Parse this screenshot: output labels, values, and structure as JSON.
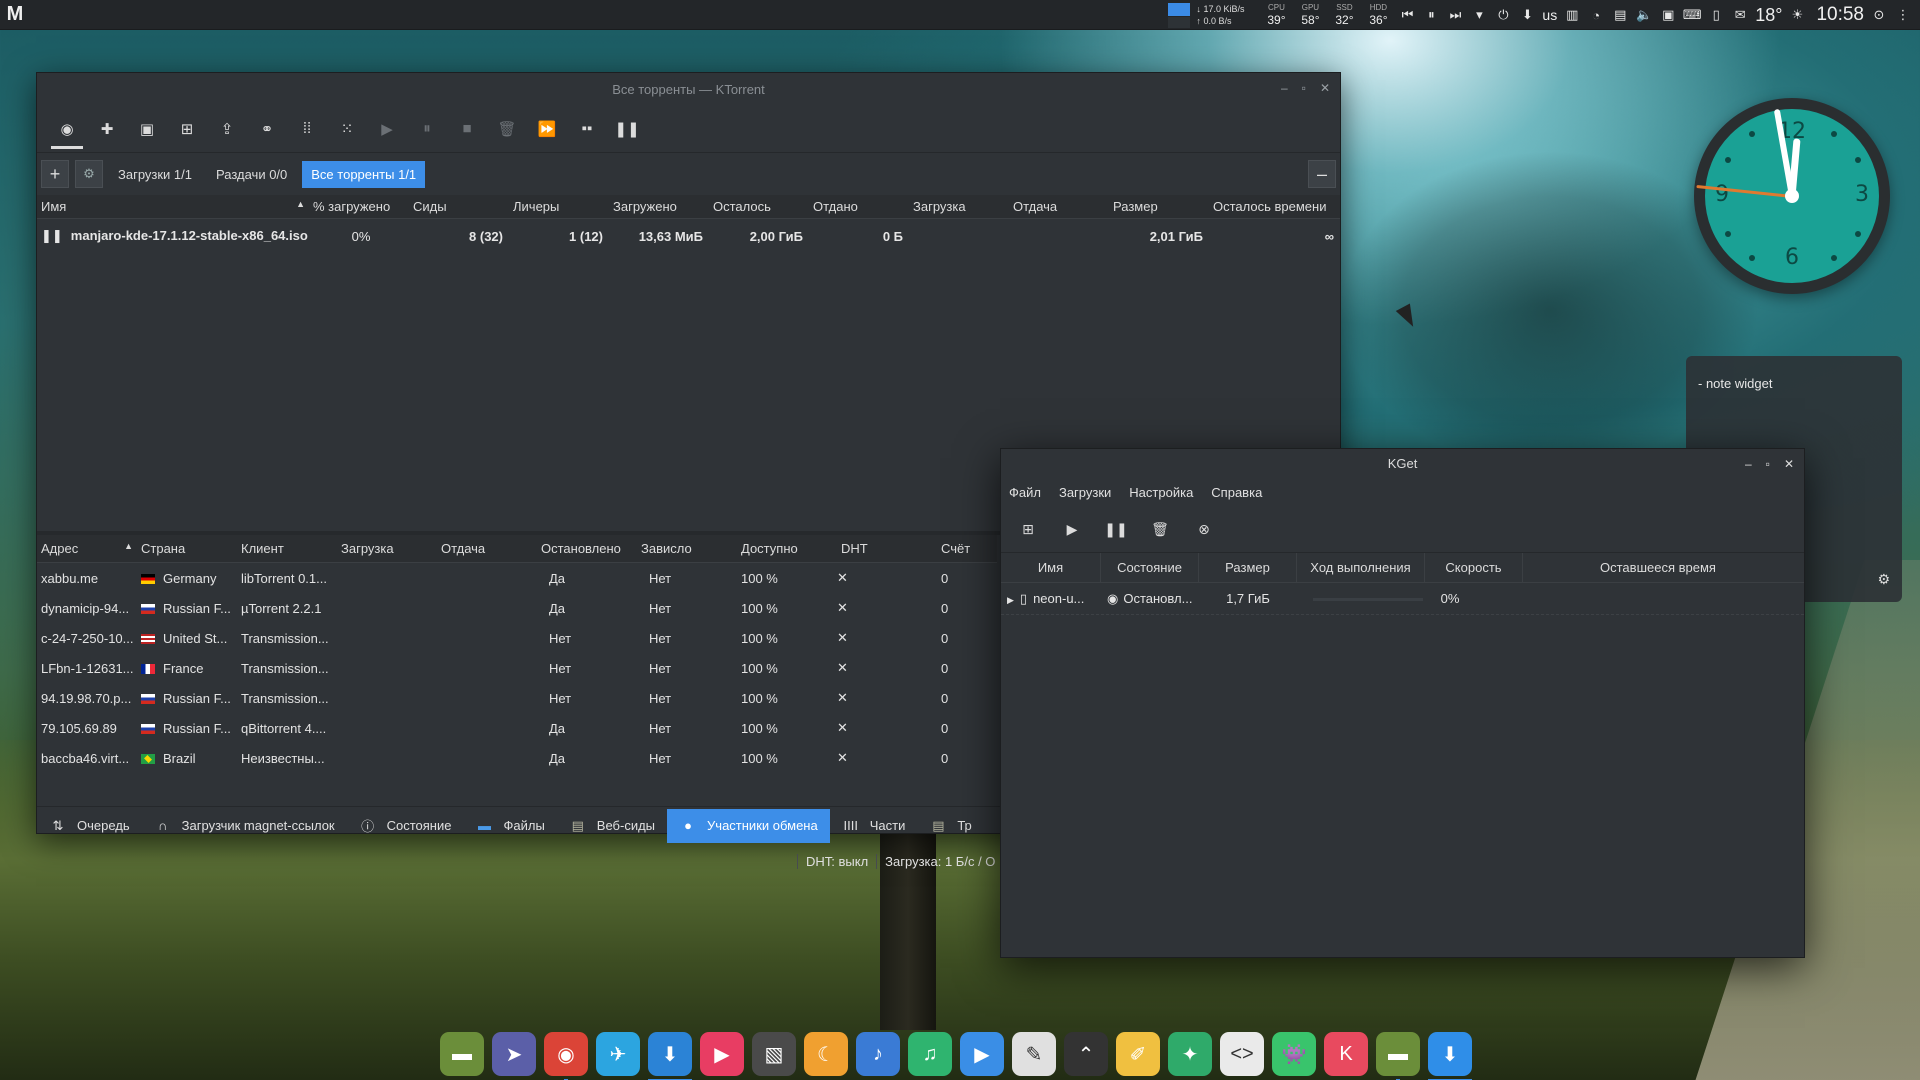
{
  "top_panel": {
    "launcher": "M",
    "net_down": "17.0 KiB/s",
    "net_up": "0.0 B/s",
    "sensors": [
      {
        "label": "CPU",
        "value": "39°"
      },
      {
        "label": "GPU",
        "value": "58°"
      },
      {
        "label": "SSD",
        "value": "32°"
      },
      {
        "label": "HDD",
        "value": "36°"
      }
    ],
    "lang": "us",
    "temperature": "18°",
    "time": "10:58"
  },
  "ktorrent": {
    "title": "Все торренты — KTorrent",
    "view_tabs": [
      {
        "label": "Загрузки 1/1"
      },
      {
        "label": "Раздачи 0/0"
      },
      {
        "label": "Все торренты 1/1"
      }
    ],
    "columns": [
      "Имя",
      "% загружено",
      "Сиды",
      "Личеры",
      "Загружено",
      "Осталось",
      "Отдано",
      "Загрузка",
      "Отдача",
      "Размер",
      "Осталось времени"
    ],
    "torrents": [
      {
        "name": "manjaro-kde-17.1.12-stable-x86_64.iso",
        "percent": "0%",
        "seeds": "8 (32)",
        "leechers": "1 (12)",
        "downloaded": "13,63 МиБ",
        "left": "2,00 ГиБ",
        "uploaded": "0 Б",
        "dl_speed": "",
        "ul_speed": "",
        "size": "2,01 ГиБ",
        "time_left": "∞"
      }
    ],
    "peer_columns": [
      "Адрес",
      "Страна",
      "Клиент",
      "Загрузка",
      "Отдача",
      "Остановлено",
      "Зависло",
      "Доступно",
      "DHT",
      "Счёт"
    ],
    "peers": [
      {
        "address": "xabbu.me",
        "flag": "de",
        "country": "Germany",
        "client": "libTorrent 0.1...",
        "choked": "Да",
        "snubbed": "Нет",
        "available": "100 %",
        "dht": "✕",
        "score": "0"
      },
      {
        "address": "dynamicip-94...",
        "flag": "ru",
        "country": "Russian F...",
        "client": "µTorrent 2.2.1",
        "choked": "Да",
        "snubbed": "Нет",
        "available": "100 %",
        "dht": "✕",
        "score": "0"
      },
      {
        "address": "c-24-7-250-10...",
        "flag": "us",
        "country": "United St...",
        "client": "Transmission...",
        "choked": "Нет",
        "snubbed": "Нет",
        "available": "100 %",
        "dht": "✕",
        "score": "0"
      },
      {
        "address": "LFbn-1-12631...",
        "flag": "fr",
        "country": "France",
        "client": "Transmission...",
        "choked": "Нет",
        "snubbed": "Нет",
        "available": "100 %",
        "dht": "✕",
        "score": "0"
      },
      {
        "address": "94.19.98.70.p...",
        "flag": "ru",
        "country": "Russian F...",
        "client": "Transmission...",
        "choked": "Нет",
        "snubbed": "Нет",
        "available": "100 %",
        "dht": "✕",
        "score": "0"
      },
      {
        "address": "79.105.69.89",
        "flag": "ru",
        "country": "Russian F...",
        "client": "qBittorrent 4....",
        "choked": "Да",
        "snubbed": "Нет",
        "available": "100 %",
        "dht": "✕",
        "score": "0"
      },
      {
        "address": "baccba46.virt...",
        "flag": "br",
        "country": "Brazil",
        "client": "Неизвестны...",
        "choked": "Да",
        "snubbed": "Нет",
        "available": "100 %",
        "dht": "✕",
        "score": "0"
      }
    ],
    "bottom_tabs": [
      {
        "label": "Очередь",
        "icon": "queue-icon"
      },
      {
        "label": "Загрузчик magnet-ссылок",
        "icon": "magnet-icon"
      },
      {
        "label": "Состояние",
        "icon": "info-icon"
      },
      {
        "label": "Файлы",
        "icon": "folder-icon"
      },
      {
        "label": "Веб-сиды",
        "icon": "webseed-icon"
      },
      {
        "label": "Участники обмена",
        "icon": "user-icon"
      },
      {
        "label": "Части",
        "icon": "chunks-icon"
      },
      {
        "label": "Тр",
        "icon": "tracker-icon"
      }
    ],
    "status": {
      "dht": "DHT: выкл",
      "speed": "Загрузка: 1 Б/с / О"
    }
  },
  "kget": {
    "title": "KGet",
    "menu": [
      "Файл",
      "Загрузки",
      "Настройка",
      "Справка"
    ],
    "columns": [
      "Имя",
      "Состояние",
      "Размер",
      "Ход выполнения",
      "Скорость",
      "Оставшееся время"
    ],
    "transfers": [
      {
        "name": "neon-u...",
        "state": "Остановл...",
        "size": "1,7 ГиБ",
        "progress": 0,
        "progress_label": "0%",
        "speed": "",
        "remaining": ""
      }
    ]
  },
  "note_widget": {
    "text": "- note widget"
  },
  "clock_widget": {
    "numbers": [
      "12",
      "3",
      "6",
      "9"
    ]
  },
  "dock": [
    {
      "name": "file-manager",
      "color": "#6b8e3a"
    },
    {
      "name": "pointer-app",
      "color": "#5b5fa8"
    },
    {
      "name": "chrome",
      "color": "#db4437"
    },
    {
      "name": "telegram",
      "color": "#2ca5e0"
    },
    {
      "name": "downloader",
      "color": "#2b83d6"
    },
    {
      "name": "media-player",
      "color": "#e83d63"
    },
    {
      "name": "photo-app",
      "color": "#4a4a4a"
    },
    {
      "name": "moon-app",
      "color": "#f0a030"
    },
    {
      "name": "audio-player",
      "color": "#3a7bd5"
    },
    {
      "name": "music",
      "color": "#2fb46f"
    },
    {
      "name": "video-app",
      "color": "#3a8ee6"
    },
    {
      "name": "text-editor",
      "color": "#e0e0e0"
    },
    {
      "name": "terminal-arrow",
      "color": "#333"
    },
    {
      "name": "color-picker",
      "color": "#f0c040"
    },
    {
      "name": "tools",
      "color": "#2faa6a"
    },
    {
      "name": "code-editor",
      "color": "#eaeaea"
    },
    {
      "name": "ghost-app",
      "color": "#39c46c"
    },
    {
      "name": "krita",
      "color": "#e84a5f"
    },
    {
      "name": "archive",
      "color": "#6b8e3a"
    },
    {
      "name": "kget",
      "color": "#2f8ee8"
    }
  ]
}
